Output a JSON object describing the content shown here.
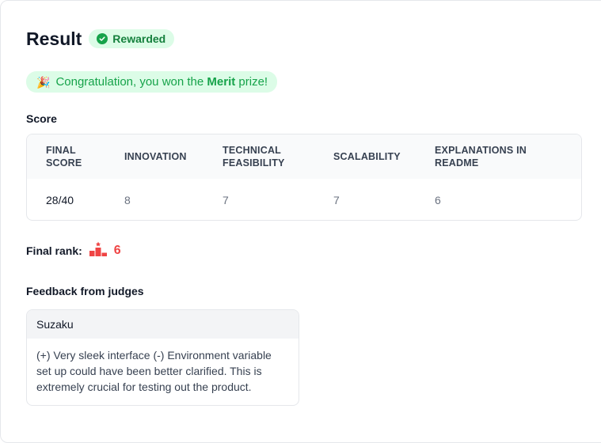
{
  "header": {
    "title": "Result",
    "badge": "Rewarded"
  },
  "banner": {
    "emoji": "🎉",
    "prefix": "Congratulation, you won the ",
    "prize": "Merit",
    "suffix": " prize!"
  },
  "score": {
    "section_label": "Score",
    "columns": [
      "Final score",
      "Innovation",
      "Technical feasibility",
      "Scalability",
      "Explanations in README"
    ],
    "values": [
      "28/40",
      "8",
      "7",
      "7",
      "6"
    ]
  },
  "rank": {
    "label": "Final rank:",
    "value": "6",
    "icon": "podium-icon"
  },
  "feedback": {
    "section_label": "Feedback from judges",
    "judge": "Suzaku",
    "text": "(+) Very sleek interface (-) Environment variable set up could have been better clarified. This is extremely crucial for testing out the product."
  },
  "colors": {
    "success_bg": "#dcfce7",
    "success_text": "#16a34a",
    "rank_red": "#ef4444"
  }
}
